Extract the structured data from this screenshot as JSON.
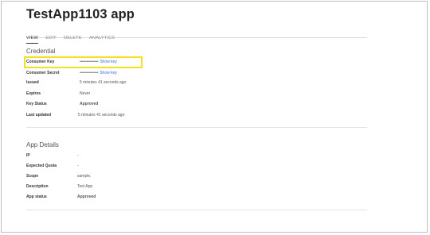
{
  "app": {
    "title": "TestApp1103 app"
  },
  "tabs": [
    {
      "label": "VIEW",
      "active": true
    },
    {
      "label": "EDIT",
      "active": false
    },
    {
      "label": "DELETE",
      "active": false
    },
    {
      "label": "ANALYTICS",
      "active": false
    }
  ],
  "credential": {
    "heading": "Credential",
    "consumer_key": {
      "label": "Consumer Key",
      "masked": "••••••••••••••••",
      "link": "Show key"
    },
    "consumer_secret": {
      "label": "Consumer Secret",
      "masked": "••••••••••••••••",
      "link": "Show key"
    },
    "issued": {
      "label": "Issued",
      "value": "5 minutes 41 seconds ago"
    },
    "expires": {
      "label": "Expires",
      "value": "Never"
    },
    "key_status": {
      "label": "Key Status",
      "value": "Approved"
    },
    "last_updated": {
      "label": "Last updated",
      "value": "5 minutes 41 seconds ago"
    }
  },
  "app_details": {
    "heading": "App Details",
    "ip": {
      "label": "IP",
      "value": "-"
    },
    "expected_quota": {
      "label": "Expected Quota",
      "value": "-"
    },
    "scope": {
      "label": "Scope",
      "value": "sample,"
    },
    "description": {
      "label": "Description",
      "value": "Test App"
    },
    "app_status": {
      "label": "App status",
      "value": "Approved"
    }
  },
  "colors": {
    "link": "#3a6fd8",
    "approved": "#3aaa55",
    "highlight": "#f3e01a"
  }
}
